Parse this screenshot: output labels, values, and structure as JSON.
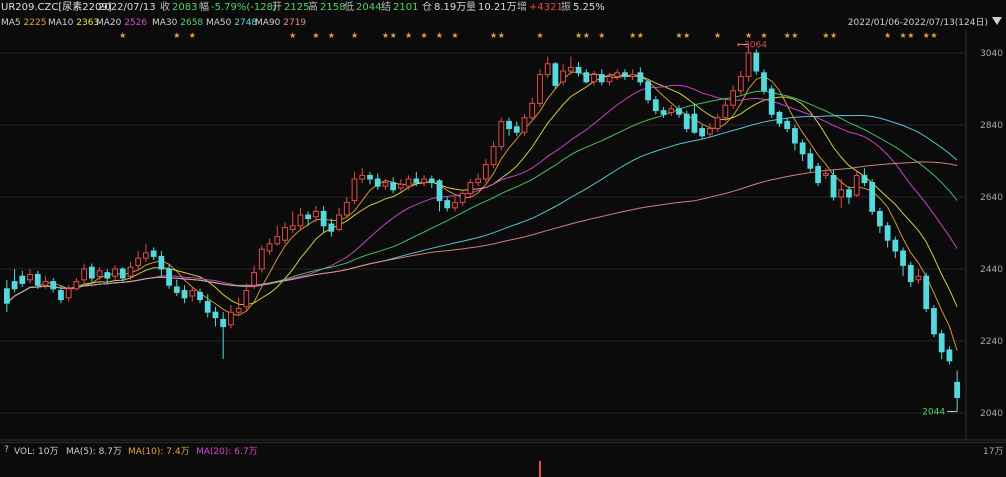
{
  "header": {
    "symbol": "UR209.CZC[尿素2209]",
    "date": "2022/07/13",
    "close_label": "收",
    "close_value": "2083",
    "change_label": "幅",
    "change_value": "-5.79%(-128)",
    "open_label": "开",
    "open_value": "2125",
    "high_label": "高",
    "high_value": "2158",
    "low_label": "低",
    "low_value": "2044",
    "settle_label": "结",
    "settle_value": "2101",
    "oi_label": "仓",
    "oi_value": "8.19万",
    "vol_label": "量",
    "vol_value": "10.21万",
    "inc_label": "增",
    "inc_value": "+4321",
    "amp_label": "振",
    "amp_value": "5.25%"
  },
  "ma_legend": [
    {
      "name": "MA5",
      "value": "2225",
      "color": "#e8a33a"
    },
    {
      "name": "MA10",
      "value": "2363",
      "color": "#e6e04a"
    },
    {
      "name": "MA20",
      "value": "2526",
      "color": "#d94ad9"
    },
    {
      "name": "MA30",
      "value": "2658",
      "color": "#4fd36a"
    },
    {
      "name": "MA50",
      "value": "2748",
      "color": "#5ed8e8"
    },
    {
      "name": "MA90",
      "value": "2719",
      "color": "#e88b8b"
    }
  ],
  "range_label": "2022/01/06-2022/07/13(124日)",
  "colors": {
    "up": "#e24b4b",
    "down": "#56d8dc",
    "grid": "#262626",
    "star": "#e8a33a",
    "axis_text": "#a8a8a8"
  },
  "chart_data": {
    "type": "candlestick",
    "y_axis_ticks": [
      3040,
      2840,
      2640,
      2440,
      2240,
      2040
    ],
    "ylim": [
      2020,
      3060
    ],
    "grid": true,
    "annotations": [
      {
        "text": "3064",
        "value": 3064,
        "color": "#e24b4b"
      },
      {
        "text": "2044",
        "value": 2044,
        "color": "#4fd36a"
      }
    ],
    "candles": [
      [
        2385,
        2345,
        2410,
        2320
      ],
      [
        2405,
        2385,
        2440,
        2375
      ],
      [
        2420,
        2400,
        2435,
        2390
      ],
      [
        2410,
        2425,
        2440,
        2400
      ],
      [
        2425,
        2395,
        2435,
        2385
      ],
      [
        2395,
        2405,
        2420,
        2385
      ],
      [
        2405,
        2385,
        2415,
        2375
      ],
      [
        2380,
        2355,
        2395,
        2345
      ],
      [
        2360,
        2385,
        2395,
        2350
      ],
      [
        2385,
        2405,
        2415,
        2380
      ],
      [
        2410,
        2440,
        2455,
        2400
      ],
      [
        2445,
        2415,
        2455,
        2400
      ],
      [
        2420,
        2435,
        2445,
        2410
      ],
      [
        2430,
        2415,
        2440,
        2400
      ],
      [
        2420,
        2440,
        2450,
        2410
      ],
      [
        2440,
        2415,
        2445,
        2405
      ],
      [
        2420,
        2445,
        2460,
        2410
      ],
      [
        2450,
        2470,
        2490,
        2440
      ],
      [
        2470,
        2485,
        2510,
        2460
      ],
      [
        2490,
        2475,
        2500,
        2465
      ],
      [
        2475,
        2440,
        2490,
        2420
      ],
      [
        2440,
        2395,
        2455,
        2385
      ],
      [
        2390,
        2375,
        2410,
        2365
      ],
      [
        2380,
        2360,
        2395,
        2345
      ],
      [
        2365,
        2380,
        2390,
        2350
      ],
      [
        2375,
        2355,
        2385,
        2345
      ],
      [
        2350,
        2320,
        2370,
        2305
      ],
      [
        2320,
        2305,
        2335,
        2280
      ],
      [
        2300,
        2280,
        2320,
        2190
      ],
      [
        2285,
        2320,
        2340,
        2275
      ],
      [
        2320,
        2330,
        2360,
        2310
      ],
      [
        2335,
        2380,
        2400,
        2325
      ],
      [
        2395,
        2430,
        2450,
        2385
      ],
      [
        2440,
        2495,
        2505,
        2430
      ],
      [
        2490,
        2510,
        2525,
        2480
      ],
      [
        2510,
        2530,
        2560,
        2505
      ],
      [
        2520,
        2555,
        2570,
        2510
      ],
      [
        2550,
        2560,
        2600,
        2540
      ],
      [
        2560,
        2590,
        2610,
        2550
      ],
      [
        2590,
        2580,
        2600,
        2560
      ],
      [
        2585,
        2600,
        2615,
        2570
      ],
      [
        2600,
        2560,
        2615,
        2540
      ],
      [
        2565,
        2545,
        2580,
        2530
      ],
      [
        2550,
        2590,
        2610,
        2545
      ],
      [
        2590,
        2625,
        2640,
        2585
      ],
      [
        2630,
        2690,
        2710,
        2620
      ],
      [
        2690,
        2700,
        2720,
        2680
      ],
      [
        2700,
        2690,
        2710,
        2675
      ],
      [
        2690,
        2670,
        2705,
        2660
      ],
      [
        2670,
        2680,
        2690,
        2660
      ],
      [
        2680,
        2660,
        2695,
        2650
      ],
      [
        2665,
        2675,
        2690,
        2655
      ],
      [
        2670,
        2690,
        2700,
        2660
      ],
      [
        2690,
        2680,
        2710,
        2670
      ],
      [
        2680,
        2690,
        2700,
        2670
      ],
      [
        2690,
        2680,
        2700,
        2665
      ],
      [
        2685,
        2630,
        2690,
        2600
      ],
      [
        2630,
        2610,
        2640,
        2600
      ],
      [
        2610,
        2625,
        2640,
        2600
      ],
      [
        2625,
        2650,
        2660,
        2615
      ],
      [
        2650,
        2680,
        2690,
        2640
      ],
      [
        2680,
        2690,
        2705,
        2670
      ],
      [
        2690,
        2730,
        2745,
        2680
      ],
      [
        2730,
        2780,
        2795,
        2720
      ],
      [
        2780,
        2850,
        2860,
        2770
      ],
      [
        2850,
        2830,
        2860,
        2810
      ],
      [
        2835,
        2820,
        2850,
        2810
      ],
      [
        2820,
        2860,
        2870,
        2810
      ],
      [
        2860,
        2900,
        2915,
        2850
      ],
      [
        2900,
        2980,
        2995,
        2890
      ],
      [
        2980,
        3010,
        3030,
        2970
      ],
      [
        3010,
        2950,
        3015,
        2940
      ],
      [
        2960,
        2990,
        3010,
        2950
      ],
      [
        2990,
        3000,
        3030,
        2980
      ],
      [
        3000,
        2985,
        3015,
        2975
      ],
      [
        2985,
        2960,
        2995,
        2955
      ],
      [
        2960,
        2980,
        2990,
        2950
      ],
      [
        2980,
        2960,
        2995,
        2950
      ],
      [
        2960,
        2975,
        2985,
        2950
      ],
      [
        2975,
        2985,
        2995,
        2965
      ],
      [
        2985,
        2975,
        2995,
        2965
      ],
      [
        2975,
        2980,
        2995,
        2965
      ],
      [
        2985,
        2960,
        3000,
        2950
      ],
      [
        2960,
        2910,
        2965,
        2900
      ],
      [
        2910,
        2880,
        2920,
        2870
      ],
      [
        2880,
        2870,
        2890,
        2860
      ],
      [
        2875,
        2885,
        2895,
        2865
      ],
      [
        2885,
        2870,
        2895,
        2860
      ],
      [
        2870,
        2830,
        2880,
        2820
      ],
      [
        2870,
        2820,
        2900,
        2815
      ],
      [
        2830,
        2810,
        2840,
        2800
      ],
      [
        2815,
        2830,
        2845,
        2805
      ],
      [
        2830,
        2860,
        2870,
        2820
      ],
      [
        2860,
        2895,
        2910,
        2850
      ],
      [
        2895,
        2935,
        2950,
        2885
      ],
      [
        2935,
        2975,
        2990,
        2925
      ],
      [
        2975,
        3040,
        3064,
        2960
      ],
      [
        3040,
        2990,
        3050,
        2980
      ],
      [
        2985,
        2935,
        2995,
        2925
      ],
      [
        2940,
        2870,
        2950,
        2860
      ],
      [
        2875,
        2845,
        2880,
        2835
      ],
      [
        2850,
        2830,
        2860,
        2820
      ],
      [
        2830,
        2790,
        2840,
        2770
      ],
      [
        2790,
        2760,
        2800,
        2740
      ],
      [
        2760,
        2720,
        2775,
        2710
      ],
      [
        2725,
        2680,
        2735,
        2670
      ],
      [
        2700,
        2705,
        2720,
        2690
      ],
      [
        2700,
        2640,
        2715,
        2630
      ],
      [
        2640,
        2660,
        2690,
        2610
      ],
      [
        2660,
        2640,
        2670,
        2620
      ],
      [
        2645,
        2700,
        2710,
        2640
      ],
      [
        2700,
        2680,
        2720,
        2670
      ],
      [
        2680,
        2600,
        2690,
        2590
      ],
      [
        2600,
        2560,
        2610,
        2540
      ],
      [
        2560,
        2520,
        2570,
        2500
      ],
      [
        2520,
        2490,
        2530,
        2470
      ],
      [
        2490,
        2450,
        2500,
        2420
      ],
      [
        2450,
        2405,
        2460,
        2390
      ],
      [
        2410,
        2420,
        2440,
        2400
      ],
      [
        2420,
        2330,
        2430,
        2320
      ],
      [
        2330,
        2260,
        2340,
        2250
      ],
      [
        2260,
        2210,
        2270,
        2190
      ],
      [
        2215,
        2185,
        2225,
        2175
      ],
      [
        2125,
        2083,
        2158,
        2044
      ]
    ]
  },
  "volume_legend": {
    "label": "VOL: 10万",
    "ma5": "MA(5): 8.7万",
    "ma10": "MA(10): 7.4万",
    "ma20": "MA(20): 6.7万",
    "qmark": "?"
  },
  "vol_axis_tick": "17万"
}
